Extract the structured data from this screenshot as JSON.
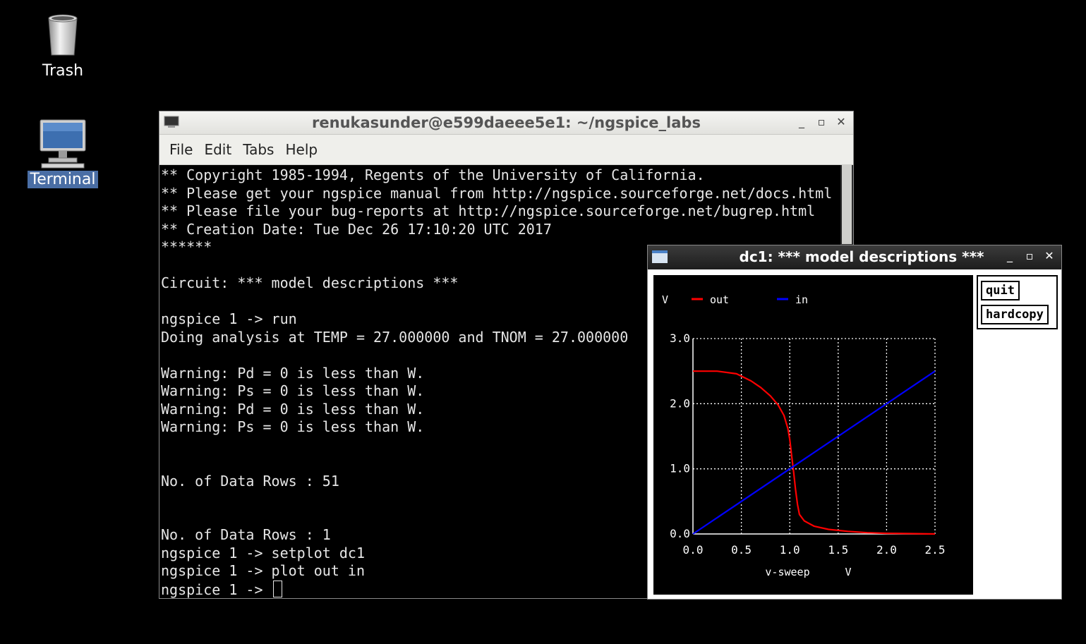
{
  "desktop": {
    "icons": [
      {
        "label": "Trash"
      },
      {
        "label": "Terminal"
      }
    ]
  },
  "terminal_window": {
    "title": "renukasunder@e599daeee5e1: ~/ngspice_labs",
    "menu": [
      "File",
      "Edit",
      "Tabs",
      "Help"
    ],
    "lines": [
      "** Copyright 1985-1994, Regents of the University of California.",
      "** Please get your ngspice manual from http://ngspice.sourceforge.net/docs.html",
      "** Please file your bug-reports at http://ngspice.sourceforge.net/bugrep.html",
      "** Creation Date: Tue Dec 26 17:10:20 UTC 2017",
      "******",
      "",
      "Circuit: *** model descriptions ***",
      "",
      "ngspice 1 -> run",
      "Doing analysis at TEMP = 27.000000 and TNOM = 27.000000",
      "",
      "Warning: Pd = 0 is less than W.",
      "Warning: Ps = 0 is less than W.",
      "Warning: Pd = 0 is less than W.",
      "Warning: Ps = 0 is less than W.",
      "",
      "",
      "No. of Data Rows : 51",
      "",
      "",
      "No. of Data Rows : 1",
      "ngspice 1 -> setplot dc1",
      "ngspice 1 -> plot out in",
      "ngspice 1 -> "
    ]
  },
  "plot_window": {
    "title": "dc1: *** model descriptions ***",
    "buttons": {
      "quit": "quit",
      "hardcopy": "hardcopy"
    }
  },
  "chart_data": {
    "type": "line",
    "ylabel": "V",
    "xlabel_name": "v-sweep",
    "xlabel_unit": "V",
    "xlim": [
      0.0,
      2.5
    ],
    "ylim": [
      0.0,
      3.0
    ],
    "xticks": [
      "0.0",
      "0.5",
      "1.0",
      "1.5",
      "2.0",
      "2.5"
    ],
    "yticks": [
      "0.0",
      "1.0",
      "2.0",
      "3.0"
    ],
    "grid": true,
    "legend_placement": "top",
    "colors": {
      "out": "#ff0000",
      "in": "#0000ff",
      "grid": "#ffffff",
      "axis": "#ffffff",
      "text": "#ffffff"
    },
    "series": [
      {
        "name": "out",
        "x": [
          0.0,
          0.25,
          0.45,
          0.6,
          0.7,
          0.8,
          0.88,
          0.94,
          0.98,
          1.0,
          1.02,
          1.04,
          1.06,
          1.08,
          1.1,
          1.15,
          1.25,
          1.4,
          1.6,
          1.8,
          2.0,
          2.25,
          2.5
        ],
        "y": [
          2.5,
          2.5,
          2.46,
          2.35,
          2.25,
          2.12,
          1.98,
          1.82,
          1.62,
          1.45,
          1.2,
          0.95,
          0.68,
          0.45,
          0.3,
          0.2,
          0.12,
          0.07,
          0.04,
          0.02,
          0.01,
          0.005,
          0.0
        ]
      },
      {
        "name": "in",
        "x": [
          0.0,
          2.5
        ],
        "y": [
          0.0,
          2.5
        ]
      }
    ]
  }
}
